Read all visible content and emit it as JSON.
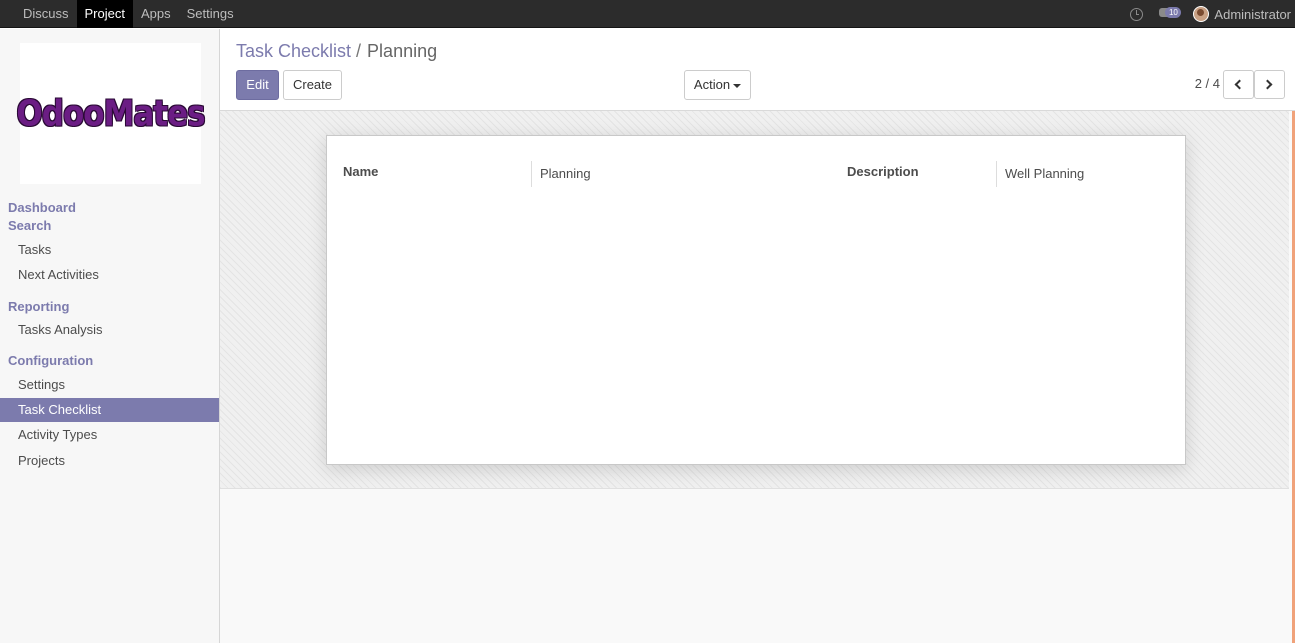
{
  "navbar": {
    "menu": [
      "Discuss",
      "Project",
      "Apps",
      "Settings"
    ],
    "active_menu": "Project",
    "message_count": "10",
    "user": "Administrator"
  },
  "sidebar": {
    "logo_text": "OdooMates",
    "sections": {
      "dashboard": "Dashboard",
      "search": "Search",
      "reporting": "Reporting",
      "configuration": "Configuration"
    },
    "items": {
      "tasks": "Tasks",
      "next_activities": "Next Activities",
      "tasks_analysis": "Tasks Analysis",
      "settings": "Settings",
      "task_checklist": "Task Checklist",
      "activity_types": "Activity Types",
      "projects": "Projects"
    },
    "active_item": "Task Checklist"
  },
  "control_panel": {
    "breadcrumb": {
      "parent": "Task Checklist",
      "separator": "/",
      "current": "Planning"
    },
    "edit_label": "Edit",
    "create_label": "Create",
    "action_label": "Action",
    "pager": "2 / 4"
  },
  "form": {
    "name_label": "Name",
    "name_value": "Planning",
    "description_label": "Description",
    "description_value": "Well Planning"
  },
  "colors": {
    "accent": "#7c7bad",
    "navbar_bg": "#2c2c2c",
    "logo": "#6b1d84"
  },
  "icons": {
    "activity": "clock-icon",
    "messages": "chat-icon",
    "pager_prev": "chevron-left-icon",
    "pager_next": "chevron-right-icon",
    "action_caret": "caret-down-icon"
  }
}
